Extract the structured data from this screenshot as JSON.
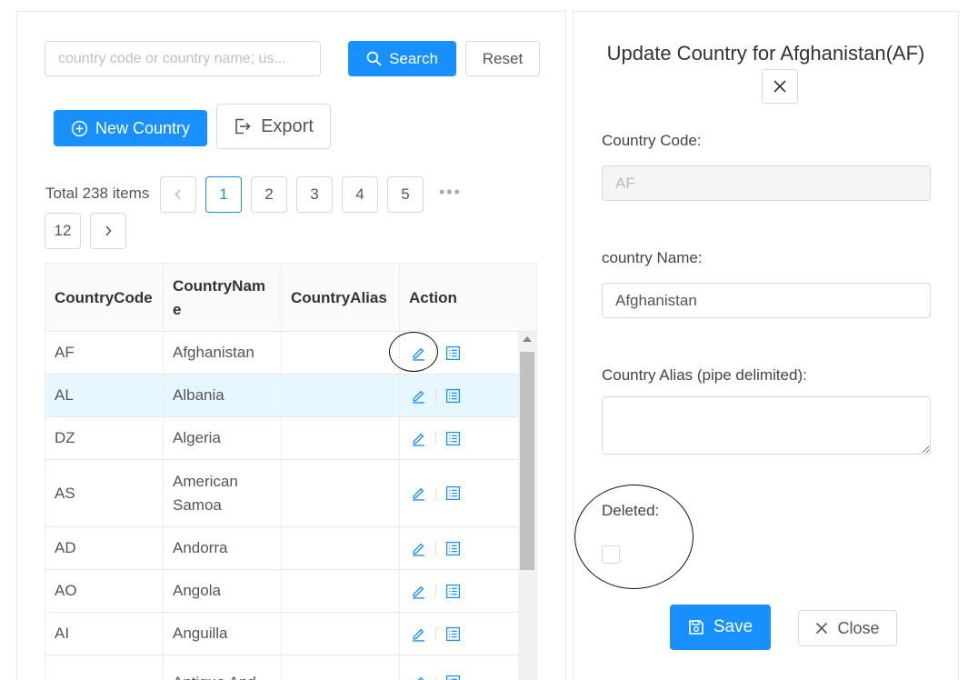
{
  "search": {
    "placeholder": "country code or country name; us...",
    "search_label": "Search",
    "reset_label": "Reset"
  },
  "toolbar": {
    "new_country_label": "New Country",
    "export_label": "Export"
  },
  "pagination": {
    "total_text": "Total 238 items",
    "prev": "<",
    "next": ">",
    "pages": [
      "1",
      "2",
      "3",
      "4",
      "5"
    ],
    "ellipsis": "•••",
    "last_page": "12",
    "current": "1"
  },
  "table": {
    "headers": [
      "CountryCode",
      "CountryNam e",
      "CountryAlias",
      "Action"
    ],
    "rows": [
      {
        "code": "AF",
        "name": "Afghanistan",
        "alias": ""
      },
      {
        "code": "AL",
        "name": "Albania",
        "alias": ""
      },
      {
        "code": "DZ",
        "name": "Algeria",
        "alias": ""
      },
      {
        "code": "AS",
        "name": "American Samoa",
        "alias": ""
      },
      {
        "code": "AD",
        "name": "Andorra",
        "alias": ""
      },
      {
        "code": "AO",
        "name": "Angola",
        "alias": ""
      },
      {
        "code": "AI",
        "name": "Anguilla",
        "alias": ""
      },
      {
        "code": "",
        "name": "Antigua And",
        "alias": ""
      }
    ]
  },
  "form": {
    "title": "Update Country for Afghanistan(AF)",
    "country_code_label": "Country Code:",
    "country_code_value": "AF",
    "country_name_label": "country Name:",
    "country_name_value": "Afghanistan",
    "country_alias_label": "Country Alias (pipe delimited):",
    "country_alias_value": "",
    "deleted_label": "Deleted:",
    "deleted_checked": false,
    "save_label": "Save",
    "close_label": "Close"
  },
  "colors": {
    "primary": "#1890ff",
    "row_highlight": "#e6f7ff"
  },
  "icons": [
    "search-icon",
    "plus-circle-icon",
    "export-icon",
    "edit-icon",
    "detail-list-icon",
    "close-icon",
    "save-icon"
  ]
}
